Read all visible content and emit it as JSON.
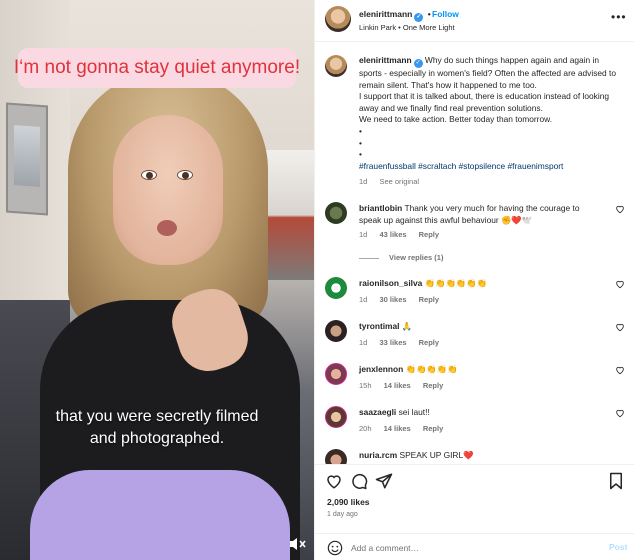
{
  "video": {
    "caption_top": "I‘m not gonna stay quiet anymore!",
    "caption_bottom_line1": "that you were secretly filmed",
    "caption_bottom_line2": "and photographed."
  },
  "header": {
    "username": "elenirittmann",
    "follow_label": "Follow",
    "separator": "•",
    "music": "Linkin Park • One More Light",
    "more_label": "•••"
  },
  "caption": {
    "username": "elenirittmann",
    "text": "Why do such things happen again and again in sports - especially in women's field? Often the affected are advised to remain silent. That's how it happened to me too.",
    "line2": "I support that it is talked about, there is education instead of looking away and we finally find real prevention solutions.",
    "line3": "We need to take action. Better today than tomorrow.",
    "bullets": [
      "•",
      "•",
      "•"
    ],
    "hashtags": "#frauenfussball #scraltach #stopsilence #frauenimsport",
    "time": "1d",
    "see_original": "See original"
  },
  "comments": [
    {
      "username": "briantlobin",
      "text": "Thank you very much for having the courage to speak up against this awful behaviour ✊❤️🕊️",
      "time": "1d",
      "likes": "43 likes",
      "reply": "Reply",
      "view_replies": "View replies (1)"
    },
    {
      "username": "raionilson_silva",
      "text": "👏👏👏👏👏👏",
      "time": "1d",
      "likes": "30 likes",
      "reply": "Reply"
    },
    {
      "username": "tyrontimal",
      "text": "🙏",
      "time": "1d",
      "likes": "33 likes",
      "reply": "Reply"
    },
    {
      "username": "jenxlennon",
      "text": "👏👏👏👏👏",
      "time": "15h",
      "likes": "14 likes",
      "reply": "Reply"
    },
    {
      "username": "saazaegli",
      "text": "sei laut!!",
      "time": "20h",
      "likes": "14 likes",
      "reply": "Reply"
    },
    {
      "username": "nuria.rcm",
      "text": "SPEAK UP GIRL❤️",
      "time": "",
      "likes": "",
      "reply": ""
    }
  ],
  "footer": {
    "likes": "2,090 likes",
    "ago": "1 day ago",
    "add_placeholder": "Add a comment…",
    "post_label": "Post"
  },
  "colors": {
    "link_blue": "#0095f6",
    "verified_blue": "#3897f0",
    "caption_pink_bg": "#fbd9e2",
    "caption_red": "#e0323c",
    "hashtag": "#00376b"
  },
  "icons": [
    "heart-icon",
    "comment-icon",
    "share-icon",
    "bookmark-icon",
    "emoji-icon",
    "mute-icon",
    "verified-icon",
    "more-icon"
  ]
}
